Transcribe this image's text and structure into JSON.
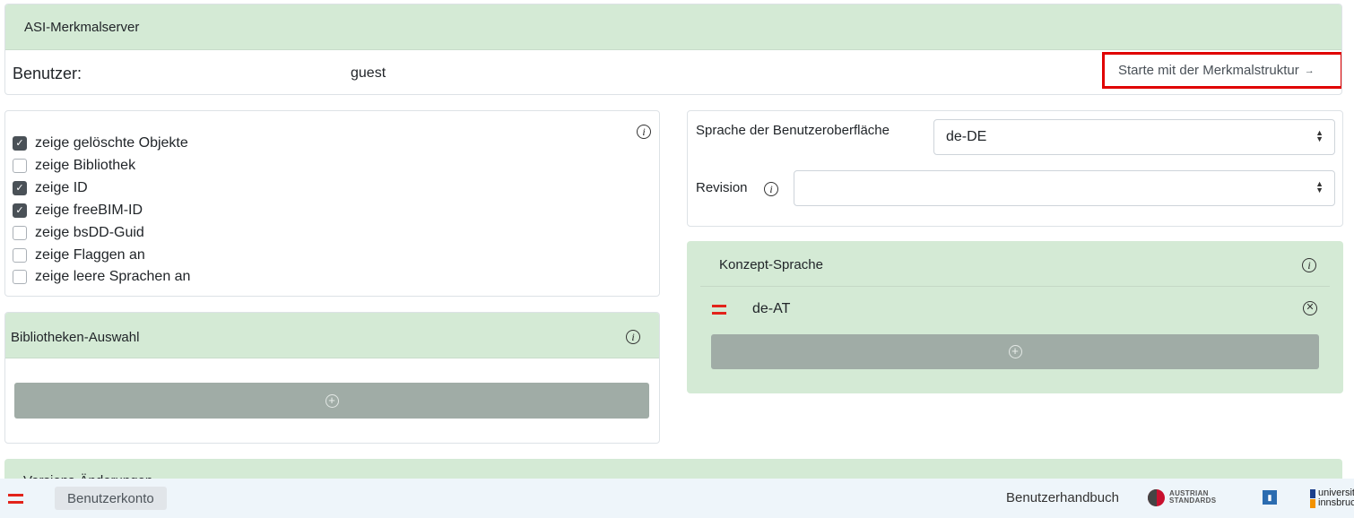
{
  "header": {
    "app_title": "ASI-Merkmalserver",
    "user_label": "Benutzer:",
    "user_value": "guest",
    "start_link": "Starte mit der Merkmalstruktur",
    "start_arrow": "→"
  },
  "options": {
    "checkboxes": [
      {
        "label": "zeige gelöschte Objekte",
        "checked": true
      },
      {
        "label": "zeige Bibliothek",
        "checked": false
      },
      {
        "label": "zeige ID",
        "checked": true
      },
      {
        "label": "zeige freeBIM-ID",
        "checked": true
      },
      {
        "label": "zeige bsDD-Guid",
        "checked": false
      },
      {
        "label": "zeige Flaggen an",
        "checked": false
      },
      {
        "label": "zeige leere Sprachen an",
        "checked": false
      }
    ]
  },
  "library_panel": {
    "title": "Bibliotheken-Auswahl"
  },
  "settings": {
    "ui_language_label": "Sprache der Benutzeroberfläche",
    "ui_language_value": "de-DE",
    "revision_label": "Revision",
    "revision_value": ""
  },
  "concept_language": {
    "title": "Konzept-Sprache",
    "items": [
      {
        "code": "de-AT"
      }
    ]
  },
  "versions_panel": {
    "title": "Versions-Änderungen"
  },
  "footer": {
    "account_button": "Benutzerkonto",
    "handbook_link": "Benutzerhandbuch",
    "austrian_standards_logo": "AUSTRIAN STANDARDS",
    "uni_logo": "universität innsbruck"
  },
  "colors": {
    "panel_green": "#d4ead5",
    "add_button_grey": "#a0aca6",
    "highlight_red": "#e00000",
    "flag_red": "#e2231a",
    "checkbox_dark": "#4a5157"
  },
  "icons": [
    "info-icon",
    "plus-circle-icon",
    "close-circle-icon",
    "austria-flag-icon",
    "select-arrows-icon",
    "arrow-right-icon"
  ]
}
